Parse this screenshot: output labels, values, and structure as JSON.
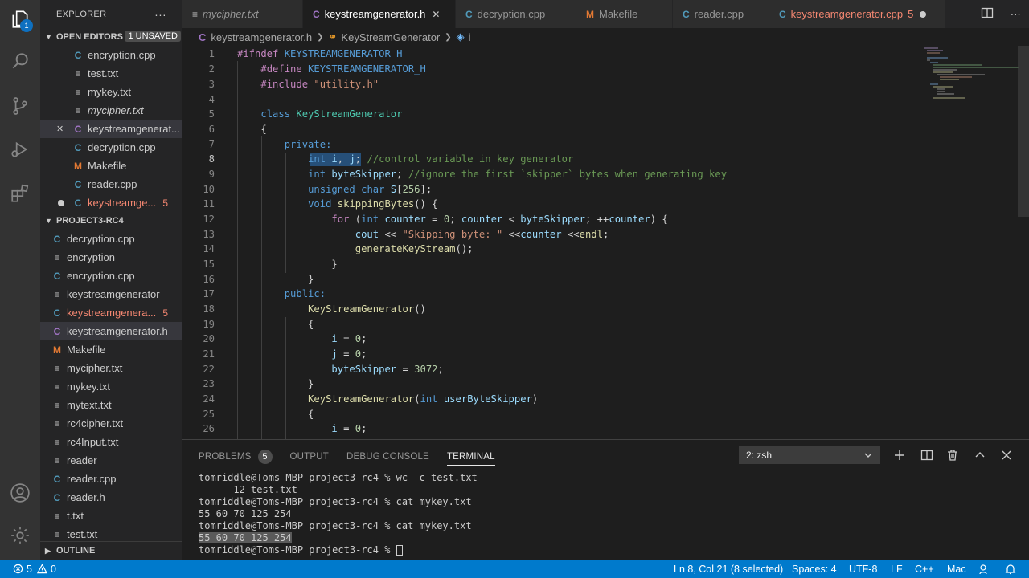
{
  "activity": {
    "badge": "1"
  },
  "sidebar": {
    "title": "EXPLORER",
    "more": "···",
    "open_editors": {
      "label": "OPEN EDITORS",
      "unsaved": "1 UNSAVED",
      "items": [
        {
          "name": "encryption.cpp",
          "icon": "C"
        },
        {
          "name": "test.txt",
          "icon": "≡"
        },
        {
          "name": "mykey.txt",
          "icon": "≡"
        },
        {
          "name": "mycipher.txt",
          "icon": "≡"
        },
        {
          "name": "keystreamgenerat...",
          "icon": "C"
        },
        {
          "name": "decryption.cpp",
          "icon": "C"
        },
        {
          "name": "Makefile",
          "icon": "M"
        },
        {
          "name": "reader.cpp",
          "icon": "C"
        },
        {
          "name": "keystreamge...",
          "icon": "C",
          "count": "5"
        }
      ]
    },
    "project": {
      "label": "PROJECT3-RC4",
      "items": [
        {
          "name": "decryption.cpp",
          "icon": "C"
        },
        {
          "name": "encryption",
          "icon": "≡"
        },
        {
          "name": "encryption.cpp",
          "icon": "C"
        },
        {
          "name": "keystreamgenerator",
          "icon": "≡"
        },
        {
          "name": "keystreamgenera...",
          "icon": "C",
          "count": "5"
        },
        {
          "name": "keystreamgenerator.h",
          "icon": "C"
        },
        {
          "name": "Makefile",
          "icon": "M"
        },
        {
          "name": "mycipher.txt",
          "icon": "≡"
        },
        {
          "name": "mykey.txt",
          "icon": "≡"
        },
        {
          "name": "mytext.txt",
          "icon": "≡"
        },
        {
          "name": "rc4cipher.txt",
          "icon": "≡"
        },
        {
          "name": "rc4Input.txt",
          "icon": "≡"
        },
        {
          "name": "reader",
          "icon": "≡"
        },
        {
          "name": "reader.cpp",
          "icon": "C"
        },
        {
          "name": "reader.h",
          "icon": "C"
        },
        {
          "name": "t.txt",
          "icon": "≡"
        },
        {
          "name": "test.txt",
          "icon": "≡"
        }
      ]
    },
    "outline": "OUTLINE"
  },
  "tabs": [
    {
      "name": "mycipher.txt",
      "icon": "≡"
    },
    {
      "name": "keystreamgenerator.h",
      "icon": "C",
      "close": "✕"
    },
    {
      "name": "decryption.cpp",
      "icon": "C"
    },
    {
      "name": "Makefile",
      "icon": "M"
    },
    {
      "name": "reader.cpp",
      "icon": "C"
    },
    {
      "name": "keystreamgenerator.cpp",
      "icon": "C",
      "count": "5"
    }
  ],
  "breadcrumb": {
    "file": "keystreamgenerator.h",
    "cls": "KeyStreamGenerator",
    "member": "i"
  },
  "editor": {
    "line_numbers": [
      "1",
      "2",
      "3",
      "4",
      "5",
      "6",
      "7",
      "8",
      "9",
      "10",
      "11",
      "12",
      "13",
      "14",
      "15",
      "16",
      "17",
      "18",
      "19",
      "20",
      "21",
      "22",
      "23",
      "24",
      "25",
      "26"
    ],
    "current_line": 8
  },
  "panel": {
    "tabs": {
      "problems": "PROBLEMS",
      "problems_count": "5",
      "output": "OUTPUT",
      "debug": "DEBUG CONSOLE",
      "terminal": "TERMINAL"
    },
    "terminal_select": "2: zsh",
    "terminal_lines": [
      "tomriddle@Toms-MBP project3-rc4 % wc -c test.txt",
      "      12 test.txt",
      "tomriddle@Toms-MBP project3-rc4 % cat mykey.txt",
      "55 60 70 125 254",
      "tomriddle@Toms-MBP project3-rc4 % cat mykey.txt",
      "55 60 70 125 254",
      "tomriddle@Toms-MBP project3-rc4 % "
    ]
  },
  "status": {
    "errors": "5",
    "warnings": "0",
    "position": "Ln 8, Col 21 (8 selected)",
    "spaces": "Spaces: 4",
    "encoding": "UTF-8",
    "eol": "LF",
    "language": "C++",
    "platform": "Mac"
  },
  "colors": {
    "status_bar": "#007acc",
    "editor_bg": "#1e1e1e",
    "sidebar_bg": "#252526",
    "error": "#f48771"
  }
}
